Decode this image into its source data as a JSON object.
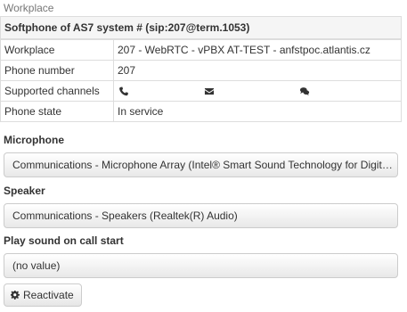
{
  "section": {
    "caption": "Workplace"
  },
  "softphone": {
    "title": "Softphone of AS7 system # (sip:207@term.1053)",
    "rows": [
      {
        "label": "Workplace",
        "value": "207 - WebRTC - vPBX AT-TEST - anfstpoc.atlantis.cz"
      },
      {
        "label": "Phone number",
        "value": "207"
      },
      {
        "label": "Supported channels",
        "channels": [
          "phone-icon",
          "envelope-icon",
          "chat-icon"
        ]
      },
      {
        "label": "Phone state",
        "value": "In service"
      }
    ]
  },
  "microphone": {
    "label": "Microphone",
    "value": "Communications - Microphone Array (Intel® Smart Sound Technology for Digital Microphones)"
  },
  "speaker": {
    "label": "Speaker",
    "value": "Communications - Speakers (Realtek(R) Audio)"
  },
  "call_start_sound": {
    "label": "Play sound on call start",
    "value": "(no value)"
  },
  "actions": {
    "reactivate_label": "Reactivate",
    "reactivate_icon": "gear-icon"
  },
  "colors": {
    "icon": "#333333",
    "heading_background": "#f5f5f5",
    "border": "#dddddd"
  }
}
